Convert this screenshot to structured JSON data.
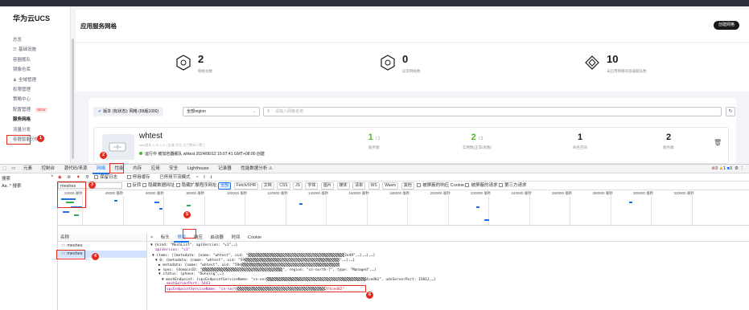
{
  "app": {
    "brand": "华为云UCS",
    "page_title": "应用服务网格",
    "create_button": "创建网格",
    "nav": [
      {
        "label": "总览",
        "icon": ""
      },
      {
        "label": "基础设施",
        "icon": "☰"
      },
      {
        "label": "容器舰队",
        "icon": ""
      },
      {
        "label": "镜像仓库",
        "icon": ""
      },
      {
        "label": "全域管理",
        "icon": "♟"
      },
      {
        "label": "权限管理",
        "icon": ""
      },
      {
        "label": "策略中心",
        "icon": ""
      },
      {
        "label": "配置管理",
        "icon": ""
      },
      {
        "label": "服务网格",
        "icon": ""
      },
      {
        "label": "流量分发",
        "icon": ""
      },
      {
        "label": "容器智能分析",
        "icon": ""
      }
    ],
    "nav_new_badge": "NEW",
    "stats": [
      {
        "value": "2",
        "label": "网格总数",
        "icon": "mesh-icon"
      },
      {
        "value": "0",
        "label": "异常网格数",
        "icon": "mesh-warn-icon"
      },
      {
        "value": "10",
        "label": "未启用网格的容器舰队数",
        "icon": "fleet-icon"
      }
    ],
    "filter": {
      "chip": "版本 (有状态): 网格 (99版1000)",
      "region": "全部region",
      "search_placeholder": "请输入网格名称"
    },
    "mesh": {
      "name": "whtest",
      "meta": "Istio版本 1.18.7-r1 | 区域 华北-乌兰察布二零三",
      "status_text": "运行中  被加容器舰队 whtest  2024/06/12 15:07:41 GMT+08:00 创建",
      "columns": [
        {
          "value": "1",
          "total": "/ 1",
          "label": "服务数",
          "green": true
        },
        {
          "value": "2",
          "total": "/ 2",
          "label": "实例数(正常/总数)",
          "green": true
        },
        {
          "value": "1",
          "total": "",
          "label": "命名空间",
          "green": false
        },
        {
          "value": "2",
          "total": "",
          "label": "服务数",
          "green": false
        }
      ]
    },
    "markers": [
      "1",
      "2",
      "3",
      "4",
      "5",
      "6"
    ]
  },
  "devtools": {
    "tabs": [
      "元素",
      "控制台",
      "源代码/来源",
      "网络",
      "性能",
      "内存",
      "应用",
      "安全",
      "Lighthouse",
      "记录器",
      "性能数据分析 ⚠"
    ],
    "active_tab": "网络",
    "status": {
      "errors": "3",
      "warnings": "1",
      "info": "3"
    },
    "search_label": "搜索",
    "aa_row": "Aa  .*  搜索",
    "toolbar": {
      "preserve_log": "保留日志",
      "disable_cache": "停用缓存",
      "throttle": "已停用节流模式"
    },
    "filter_value": "meshes",
    "invert": "反转",
    "hide_data_urls": "隐藏数据网址",
    "hide_ext_urls": "隐藏扩展程序网址",
    "types": [
      "全部",
      "Fetch/XHR",
      "文档",
      "CSS",
      "JS",
      "字体",
      "图片",
      "媒体",
      "清单",
      "WS",
      "Wasm",
      "其他"
    ],
    "blocked_cookie": "被屏蔽的响应 Cookie",
    "blocked_requests": "被屏蔽的请求",
    "third_party": "第三方请求",
    "timeline_ticks": [
      "20000 毫秒",
      "40000 毫秒",
      "60000 毫秒",
      "80000 毫秒",
      "100000 毫秒",
      "120000 毫秒",
      "140000 毫秒",
      "160000 毫秒",
      "180000 毫秒",
      "200000 毫秒",
      "220000 毫秒",
      "240000 毫秒",
      "260000 毫秒",
      "280000 毫秒",
      "300000 毫秒",
      "320000 毫秒"
    ],
    "list_header": "名称",
    "requests": [
      "meshes",
      "meshes"
    ],
    "detail_tabs": [
      "×",
      "标头",
      "预览",
      "响应",
      "启动器",
      "时间",
      "Cookie"
    ],
    "active_detail_tab": "预览",
    "code": {
      "l1_a": "▼ {kind: \"MeshList\", apiVersion: \"v1\",…}",
      "l2": "apiVersion: \"v1\"",
      "l3_a": "▼ items: [{metadata: {name: \"whtest\", uid: \"",
      "l3_b": "2e49\",…},…},…]",
      "l4_a": "▼ 0: {metadata: {name: \"whtest\", uid: \"59",
      "l4_b": "\",…},…}",
      "l5_a": "▶ metadata: {name: \"whtest\", uid: \"59e",
      "l5_b": "",
      "l6_a": "▶ spec: {domainID: \"",
      "l6_b": "\", region: \"cn-north-7\", type: \"Managed\",…}",
      "l7": "▼ status: {phase: \"Running\",…}",
      "l8_a": "▼ meshEndpoint: {vpcEndpointServiceName: \"cn-nor",
      "l8_b": "4ced82\", udsServerPort: 15012,…}",
      "l9": "meshServerPort: 5443",
      "l10_a": "vpcEndpointServiceName: \"cn-nort",
      "l10_b": "2f4ced82\""
    }
  }
}
